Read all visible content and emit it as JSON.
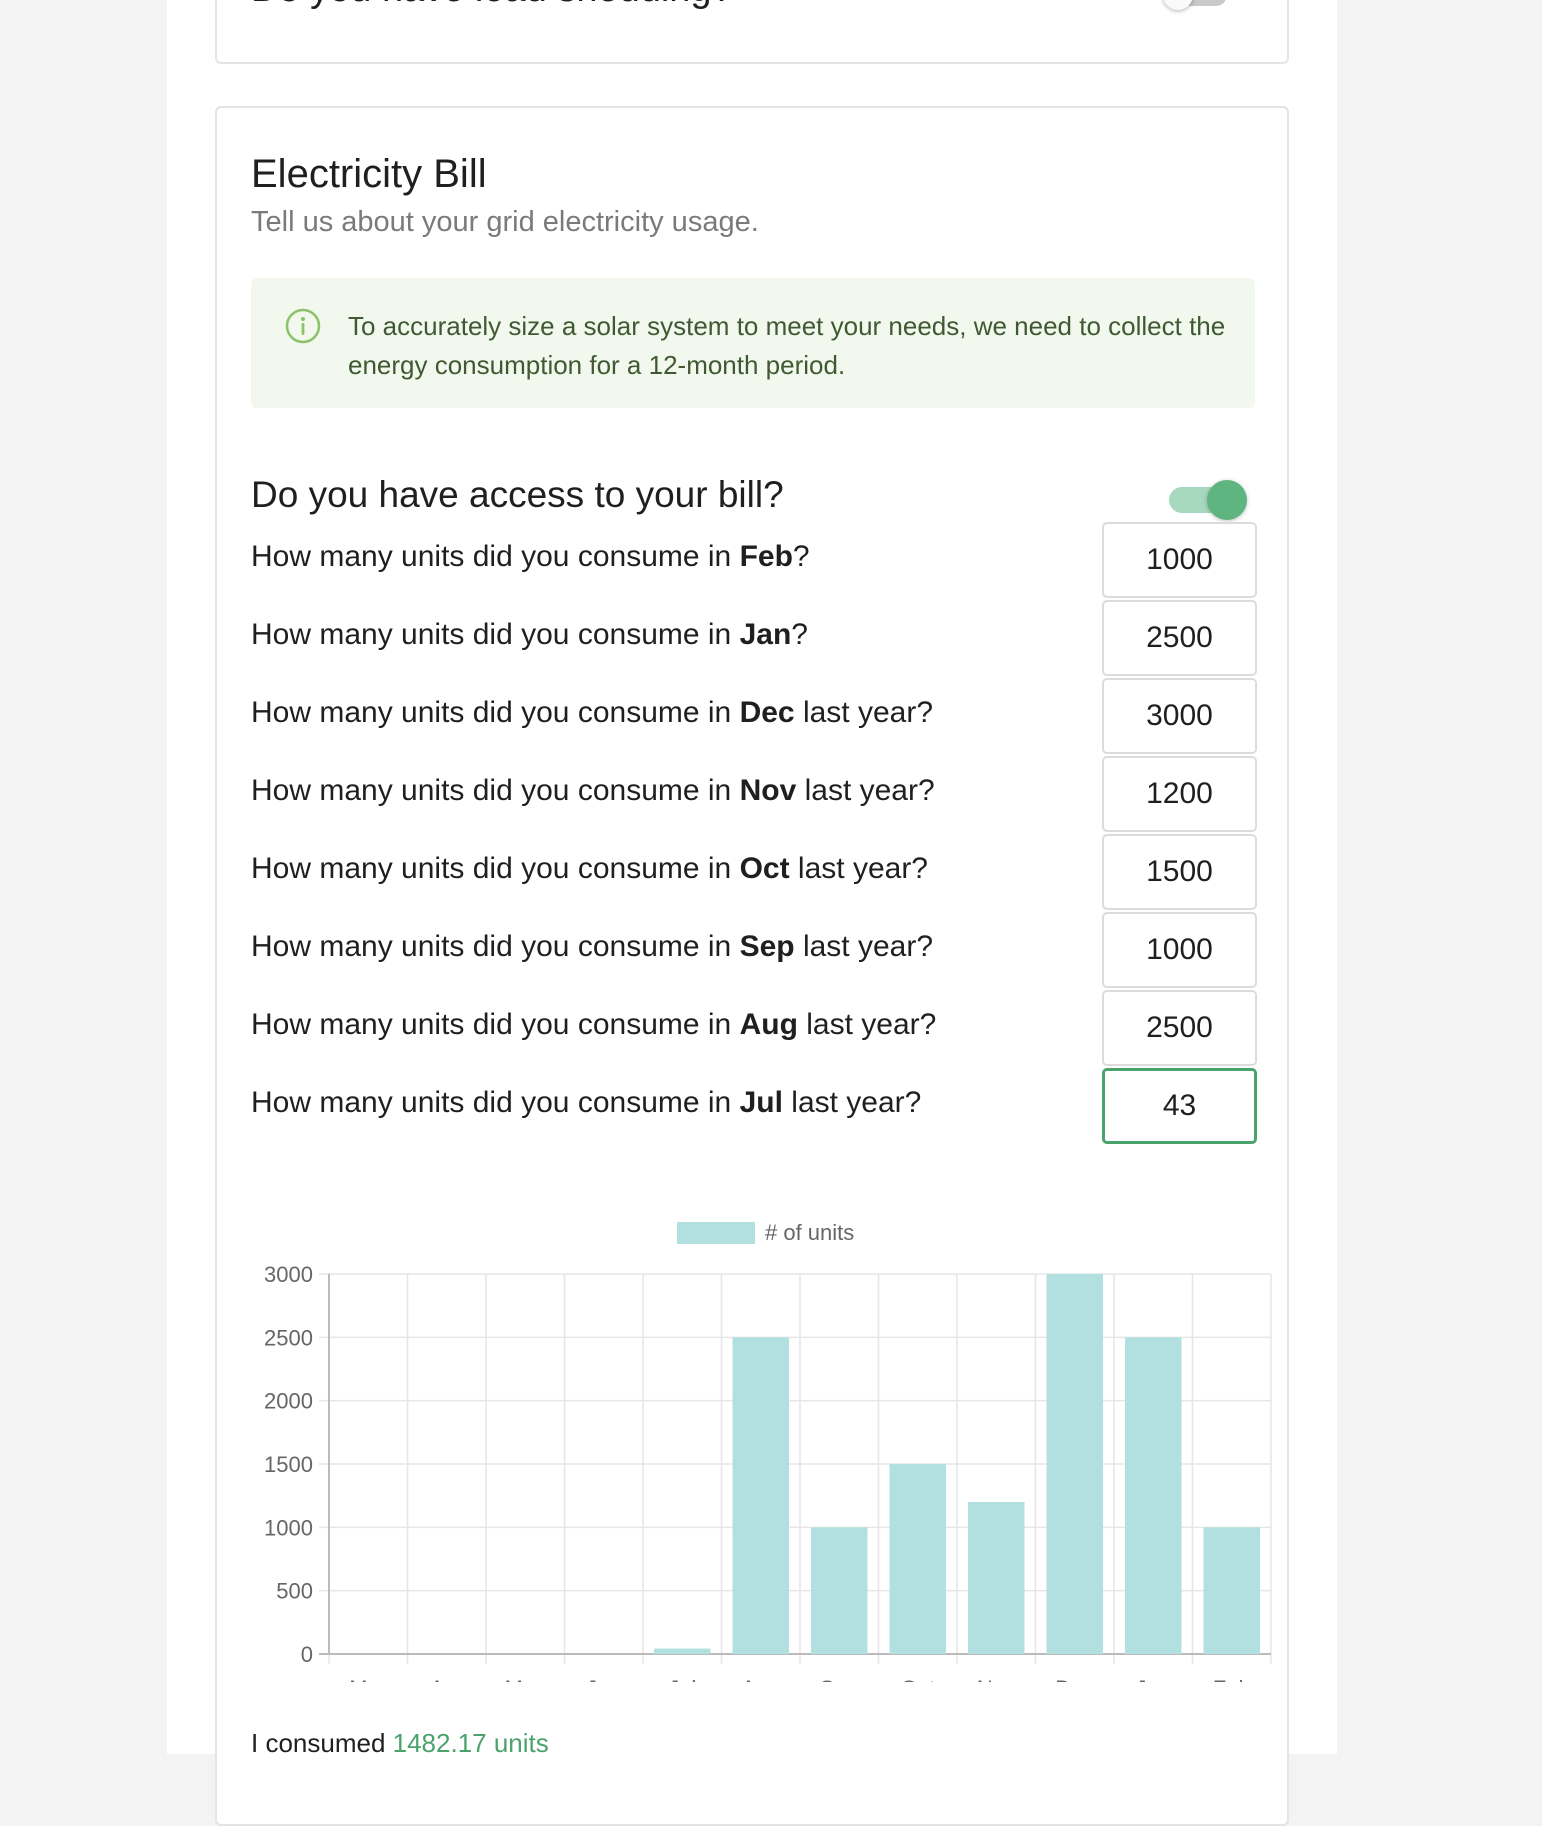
{
  "previous_card": {
    "question": "Do you have load shedding?"
  },
  "bill_card": {
    "title": "Electricity Bill",
    "subtitle": "Tell us about your grid electricity usage.",
    "info_text": "To accurately size a solar system to meet your needs, we need to collect the energy consumption for a 12-month period.",
    "access_question": "Do you have access to your bill?",
    "access_toggle_on": true
  },
  "questions": [
    {
      "prefix": "How many units did you consume in ",
      "month": "Feb",
      "suffix": "?",
      "value": "1000"
    },
    {
      "prefix": "How many units did you consume in ",
      "month": "Jan",
      "suffix": "?",
      "value": "2500"
    },
    {
      "prefix": "How many units did you consume in ",
      "month": "Dec",
      "suffix": " last year?",
      "value": "3000"
    },
    {
      "prefix": "How many units did you consume in ",
      "month": "Nov",
      "suffix": " last year?",
      "value": "1200"
    },
    {
      "prefix": "How many units did you consume in ",
      "month": "Oct",
      "suffix": " last year?",
      "value": "1500"
    },
    {
      "prefix": "How many units did you consume in ",
      "month": "Sep",
      "suffix": " last year?",
      "value": "1000"
    },
    {
      "prefix": "How many units did you consume in ",
      "month": "Aug",
      "suffix": " last year?",
      "value": "2500"
    },
    {
      "prefix": "How many units did you consume in ",
      "month": "Jul",
      "suffix": " last year?",
      "value": "43"
    }
  ],
  "chart_data": {
    "type": "bar",
    "categories": [
      "Mar",
      "Apr",
      "May",
      "Jun",
      "Jul",
      "Aug",
      "Sep",
      "Oct",
      "Nov",
      "Dec",
      "Jan",
      "Feb"
    ],
    "series": [
      {
        "name": "# of units",
        "values": [
          0,
          0,
          0,
          0,
          43,
          2500,
          1000,
          1500,
          1200,
          3000,
          2500,
          1000
        ]
      }
    ],
    "yticks": [
      0,
      500,
      1000,
      1500,
      2000,
      2500,
      3000
    ],
    "ylim": [
      0,
      3000
    ],
    "legend": "top",
    "grid": true,
    "bar_color": "#b2e0e0"
  },
  "summary": {
    "prefix": "I consumed ",
    "value": "1482.17 units"
  },
  "colors": {
    "accent": "#4aa36a",
    "bar": "#b2e0e0"
  }
}
